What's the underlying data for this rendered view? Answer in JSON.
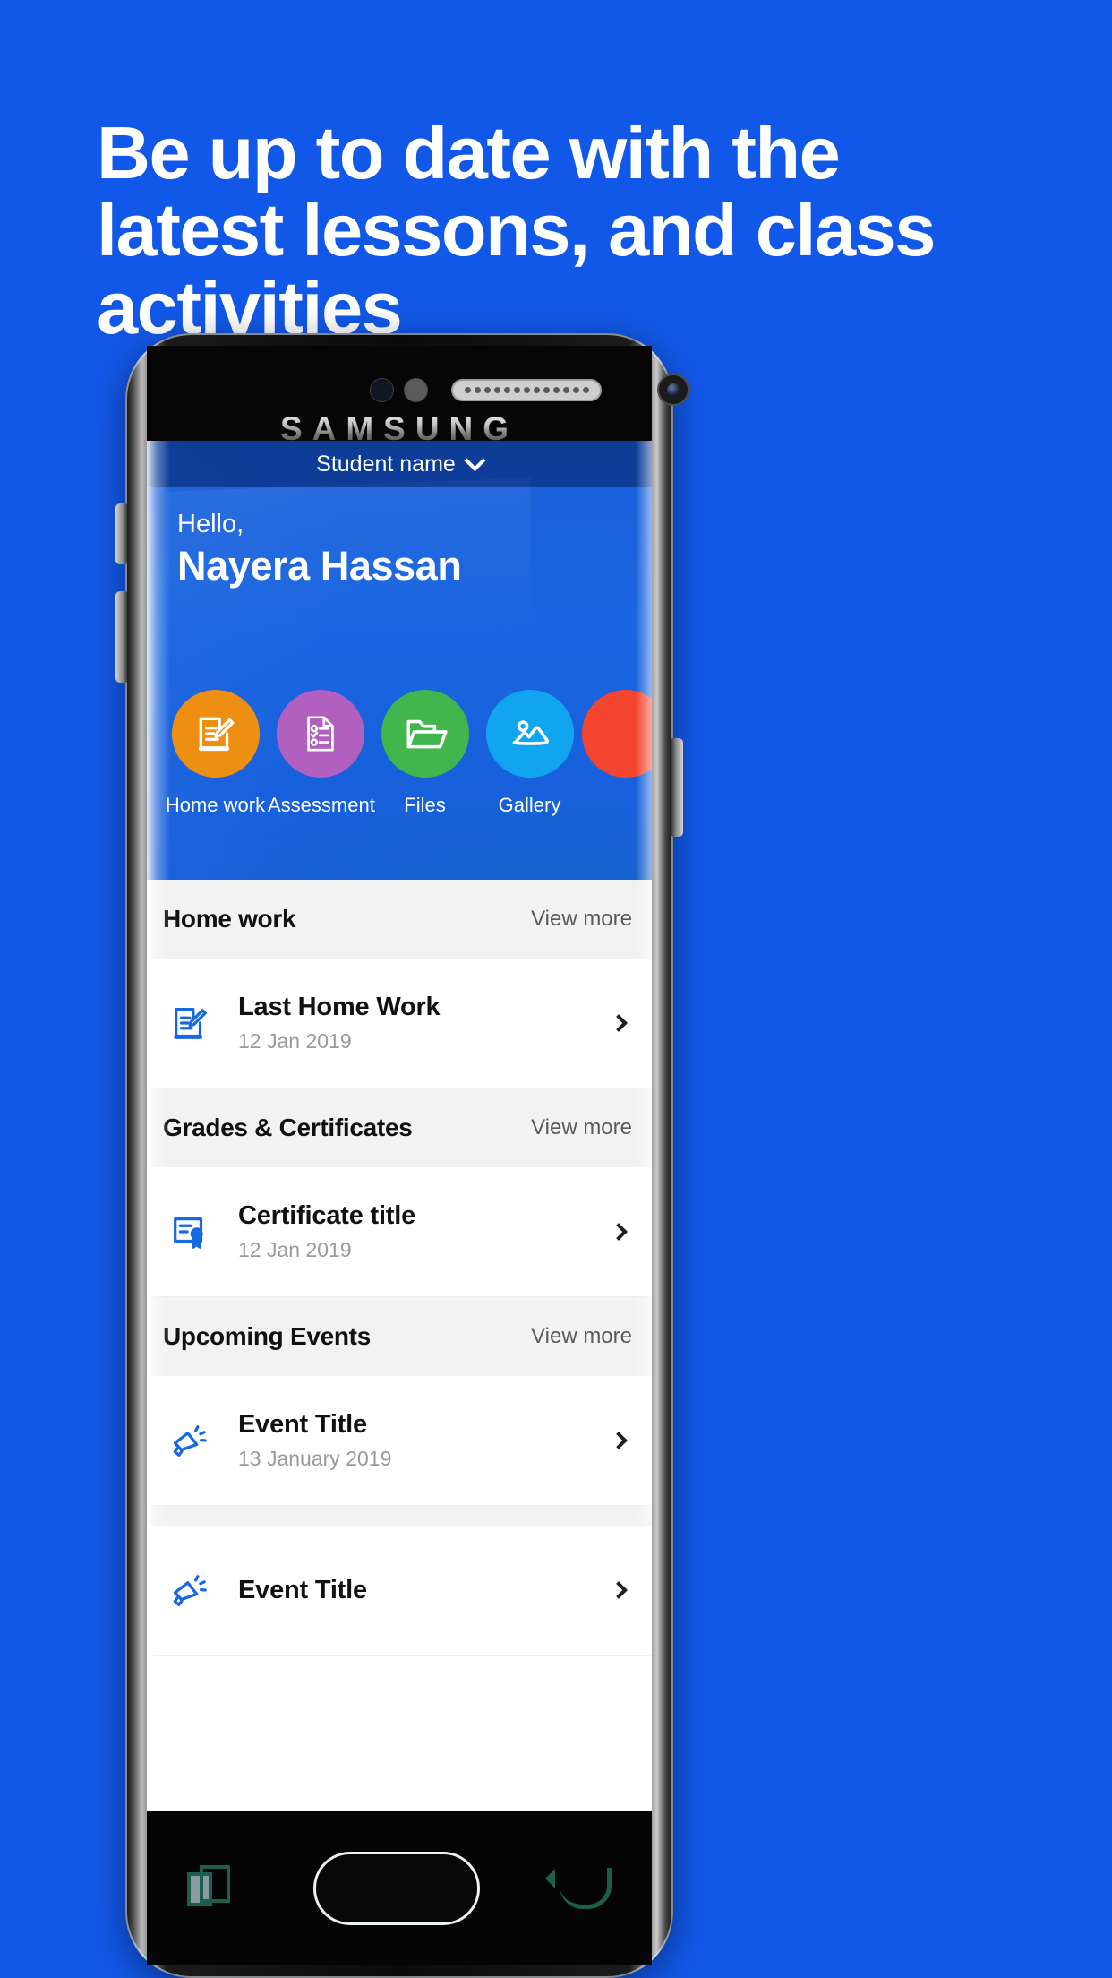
{
  "promo": {
    "headline_lines": [
      "Be up to date with the",
      "latest lessons, and class",
      "activities"
    ],
    "background_color": "#1258e8"
  },
  "device": {
    "brand": "SAMSUNG",
    "sensor_left_icon": "proximity-sensor-icon",
    "sensor_right_icon": "light-sensor-icon",
    "speaker_icon": "earpiece-speaker-icon",
    "camera_icon": "front-camera-icon"
  },
  "app": {
    "topbar": {
      "label": "Student name",
      "chevron_icon": "chevron-down-icon"
    },
    "greeting": {
      "hello": "Hello,",
      "name": "Nayera Hassan"
    },
    "quick_actions": [
      {
        "label": "Home work",
        "icon": "edit-document-icon",
        "color": "#ef8f12"
      },
      {
        "label": "Assessment",
        "icon": "checklist-page-icon",
        "color": "#b260c0"
      },
      {
        "label": "Files",
        "icon": "open-folder-icon",
        "color": "#42b54c"
      },
      {
        "label": "Gallery",
        "icon": "image-photo-icon",
        "color": "#12a5ef"
      },
      {
        "label": "",
        "icon": "more-icon",
        "color": "#f4452e"
      }
    ],
    "sections": [
      {
        "title": "Home work",
        "more": "View more",
        "rows": [
          {
            "title": "Last Home Work",
            "date": "12 Jan 2019",
            "icon": "edit-document-icon",
            "chevron": "chevron-right-icon"
          }
        ]
      },
      {
        "title": "Grades & Certificates",
        "more": "View more",
        "rows": [
          {
            "title": "Certificate title",
            "date": "12 Jan 2019",
            "icon": "certificate-icon",
            "chevron": "chevron-right-icon"
          }
        ]
      },
      {
        "title": "Upcoming Events",
        "more": "View more",
        "rows": [
          {
            "title": "Event Title",
            "date": "13 January 2019",
            "icon": "megaphone-icon",
            "chevron": "chevron-right-icon"
          },
          {
            "title": "Event Title",
            "date": "",
            "icon": "megaphone-icon",
            "chevron": "chevron-right-icon"
          }
        ]
      }
    ],
    "accent_color": "#1a6ae8",
    "list_icon_color": "#1668e3"
  },
  "navbar": {
    "recents_icon": "recent-apps-icon",
    "home_icon": "home-button-icon",
    "back_icon": "back-arrow-icon"
  }
}
